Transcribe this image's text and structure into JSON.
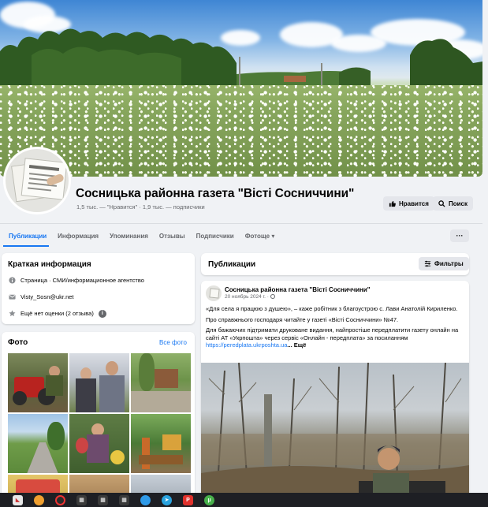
{
  "page": {
    "title": "Сосницька районна газета \"Вісті Сосниччини\"",
    "likes_text": "1,5 тыс. — \"Нравится\" · 1,9 тыс. — подписчики"
  },
  "header_buttons": {
    "like_label": "Нравится",
    "search_label": "Поиск",
    "more_label": "···"
  },
  "tabs": [
    {
      "label": "Публикации",
      "active": true
    },
    {
      "label": "Информация"
    },
    {
      "label": "Упоминания"
    },
    {
      "label": "Отзывы"
    },
    {
      "label": "Подписчики"
    },
    {
      "label": "Фотоще"
    }
  ],
  "tab_more_caret": "▾",
  "about": {
    "title": "Краткая информация",
    "items": [
      {
        "icon": "info-icon",
        "prefix": "Страница",
        "text": " · СМИ/информационное агентство"
      },
      {
        "icon": "mail-icon",
        "text": "Visty_Sosn@ukr.net"
      },
      {
        "icon": "star-icon",
        "text": "Ещё нет оценки (2 отзыва)",
        "badge": "i"
      }
    ]
  },
  "photos": {
    "title": "Фото",
    "all_link": "Все фото"
  },
  "publications": {
    "title": "Публикации",
    "filters_label": "Фильтры"
  },
  "post": {
    "author": "Сосницька районна газета \"Вісті Сосниччини\"",
    "date": "20 ноябрь 2024 г.",
    "date_sep": "·",
    "paragraph1": "«Для села я працюю з душею», – каже робітник з благоустрою с. Лави Анатолій Кириленко.",
    "paragraph2": "Про справжнього господаря читайте у газеті «Вісті Сосниччини» №47.",
    "paragraph3_text": "Для бажаючих підтримати друковане видання, найпростіше передплатити газету онлайн на сайті АТ «Укрпошта» через сервіс «Онлайн - передплата» за посиланням",
    "paragraph3_link": "https://peredplata.ukrposhta.ua",
    "paragraph3_more": "... Ещё"
  },
  "colors": {
    "accent": "#1877f2",
    "background": "#f0f2f5",
    "taskbar": "#1e1f24"
  }
}
